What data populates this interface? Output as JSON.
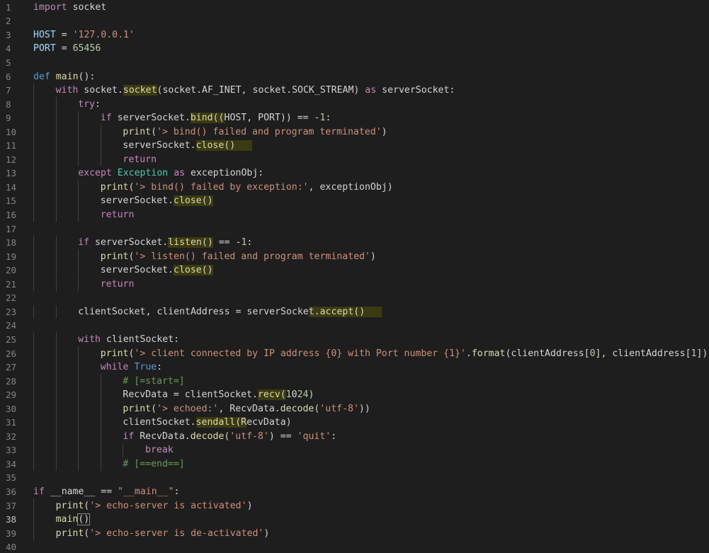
{
  "editor": {
    "language": "python",
    "active_line": 38,
    "theme": {
      "background": "#1e1e1e",
      "gutter_text": "#858585",
      "highlight": "#3b3a12"
    },
    "lines": [
      {
        "n": "1",
        "indent": 0,
        "t": [
          [
            "ctl",
            "import"
          ],
          [
            "txt",
            " socket"
          ]
        ]
      },
      {
        "n": "2",
        "indent": 0,
        "t": []
      },
      {
        "n": "3",
        "indent": 0,
        "t": [
          [
            "var",
            "HOST"
          ],
          [
            "txt",
            " = "
          ],
          [
            "str",
            "'127.0.0.1'"
          ]
        ]
      },
      {
        "n": "4",
        "indent": 0,
        "t": [
          [
            "var",
            "PORT"
          ],
          [
            "txt",
            " = "
          ],
          [
            "num",
            "65456"
          ]
        ]
      },
      {
        "n": "5",
        "indent": 0,
        "t": []
      },
      {
        "n": "6",
        "indent": 0,
        "t": [
          [
            "kw",
            "def"
          ],
          [
            "txt",
            " "
          ],
          [
            "fn",
            "main"
          ],
          [
            "txt",
            "():"
          ]
        ]
      },
      {
        "n": "7",
        "indent": 1,
        "t": [
          [
            "ctl",
            "with"
          ],
          [
            "txt",
            " socket."
          ],
          [
            "hlfn",
            "socket"
          ],
          [
            "txt",
            "(socket.AF_INET, socket.SOCK_STREAM) "
          ],
          [
            "ctl",
            "as"
          ],
          [
            "txt",
            " serverSocket:"
          ]
        ]
      },
      {
        "n": "8",
        "indent": 2,
        "t": [
          [
            "ctl",
            "try"
          ],
          [
            "txt",
            ":"
          ]
        ]
      },
      {
        "n": "9",
        "indent": 3,
        "t": [
          [
            "ctl",
            "if"
          ],
          [
            "txt",
            " serverSocket."
          ],
          [
            "hlfn",
            "bind"
          ],
          [
            "hl",
            "(("
          ],
          [
            "txt",
            "HOST, PORT)) == -"
          ],
          [
            "num",
            "1"
          ],
          [
            "txt",
            ":"
          ]
        ]
      },
      {
        "n": "10",
        "indent": 4,
        "t": [
          [
            "fn",
            "print"
          ],
          [
            "txt",
            "("
          ],
          [
            "str",
            "'> bind() failed and program terminated'"
          ],
          [
            "txt",
            ")"
          ]
        ]
      },
      {
        "n": "11",
        "indent": 4,
        "t": [
          [
            "txt",
            "serverSocket."
          ],
          [
            "hlfn",
            "close"
          ],
          [
            "hl",
            "()   "
          ]
        ]
      },
      {
        "n": "12",
        "indent": 4,
        "t": [
          [
            "ctl",
            "return"
          ]
        ]
      },
      {
        "n": "13",
        "indent": 2,
        "t": [
          [
            "ctl",
            "except"
          ],
          [
            "txt",
            " "
          ],
          [
            "cls",
            "Exception"
          ],
          [
            "txt",
            " "
          ],
          [
            "ctl",
            "as"
          ],
          [
            "txt",
            " exceptionObj:"
          ]
        ]
      },
      {
        "n": "14",
        "indent": 3,
        "t": [
          [
            "fn",
            "print"
          ],
          [
            "txt",
            "("
          ],
          [
            "str",
            "'> bind() failed by exception:'"
          ],
          [
            "txt",
            ", exceptionObj)"
          ]
        ]
      },
      {
        "n": "15",
        "indent": 3,
        "t": [
          [
            "txt",
            "serverSocket."
          ],
          [
            "hlfn",
            "close"
          ],
          [
            "hl",
            "()"
          ]
        ]
      },
      {
        "n": "16",
        "indent": 3,
        "t": [
          [
            "ctl",
            "return"
          ]
        ]
      },
      {
        "n": "17",
        "indent": 0,
        "t": []
      },
      {
        "n": "18",
        "indent": 2,
        "t": [
          [
            "ctl",
            "if"
          ],
          [
            "txt",
            " serverSocket."
          ],
          [
            "hlfn",
            "listen"
          ],
          [
            "hl",
            "()"
          ],
          [
            "txt",
            " == -"
          ],
          [
            "num",
            "1"
          ],
          [
            "txt",
            ":"
          ]
        ]
      },
      {
        "n": "19",
        "indent": 3,
        "t": [
          [
            "fn",
            "print"
          ],
          [
            "txt",
            "("
          ],
          [
            "str",
            "'> listen() failed and program terminated'"
          ],
          [
            "txt",
            ")"
          ]
        ]
      },
      {
        "n": "20",
        "indent": 3,
        "t": [
          [
            "txt",
            "serverSocket."
          ],
          [
            "hlfn",
            "close"
          ],
          [
            "hl",
            "()"
          ]
        ]
      },
      {
        "n": "21",
        "indent": 3,
        "t": [
          [
            "ctl",
            "return"
          ]
        ]
      },
      {
        "n": "22",
        "indent": 0,
        "t": []
      },
      {
        "n": "23",
        "indent": 2,
        "t": [
          [
            "txt",
            "clientSocket, clientAddress = serverSocke"
          ],
          [
            "hl",
            "t."
          ],
          [
            "hlfn",
            "accept"
          ],
          [
            "hl",
            "()   "
          ]
        ]
      },
      {
        "n": "24",
        "indent": 0,
        "t": []
      },
      {
        "n": "25",
        "indent": 2,
        "t": [
          [
            "ctl",
            "with"
          ],
          [
            "txt",
            " clientSocket:"
          ]
        ]
      },
      {
        "n": "26",
        "indent": 3,
        "t": [
          [
            "fn",
            "print"
          ],
          [
            "txt",
            "("
          ],
          [
            "str",
            "'> client connected by IP address {0} with Port number {1}'"
          ],
          [
            "txt",
            "."
          ],
          [
            "fn",
            "format"
          ],
          [
            "txt",
            "(clientAddress["
          ],
          [
            "num",
            "0"
          ],
          [
            "txt",
            "], clientAddress["
          ],
          [
            "num",
            "1"
          ],
          [
            "txt",
            "]))"
          ]
        ]
      },
      {
        "n": "27",
        "indent": 3,
        "t": [
          [
            "ctl",
            "while"
          ],
          [
            "txt",
            " "
          ],
          [
            "kw",
            "True"
          ],
          [
            "txt",
            ":"
          ]
        ]
      },
      {
        "n": "28",
        "indent": 4,
        "t": [
          [
            "cmt",
            "# [=start=]"
          ]
        ]
      },
      {
        "n": "29",
        "indent": 4,
        "t": [
          [
            "txt",
            "RecvData = clientSocket."
          ],
          [
            "hlfn",
            "recv"
          ],
          [
            "hl",
            "("
          ],
          [
            "num",
            "1"
          ],
          [
            "txt",
            "0"
          ],
          [
            "num",
            "24"
          ],
          [
            "txt",
            ")"
          ]
        ]
      },
      {
        "n": "30",
        "indent": 4,
        "t": [
          [
            "fn",
            "print"
          ],
          [
            "txt",
            "("
          ],
          [
            "str",
            "'> echoed:'"
          ],
          [
            "txt",
            ", RecvData."
          ],
          [
            "fn",
            "decode"
          ],
          [
            "txt",
            "("
          ],
          [
            "str",
            "'utf-8'"
          ],
          [
            "txt",
            "))"
          ]
        ]
      },
      {
        "n": "31",
        "indent": 4,
        "t": [
          [
            "txt",
            "clientSocket."
          ],
          [
            "hlfn",
            "sendall"
          ],
          [
            "hl",
            "("
          ],
          [
            "hl",
            "R"
          ],
          [
            "txt",
            "ecvData)"
          ]
        ]
      },
      {
        "n": "32",
        "indent": 4,
        "t": [
          [
            "ctl",
            "if"
          ],
          [
            "txt",
            " RecvData."
          ],
          [
            "fn",
            "decode"
          ],
          [
            "txt",
            "("
          ],
          [
            "str",
            "'utf-8'"
          ],
          [
            "txt",
            ") == "
          ],
          [
            "str",
            "'quit'"
          ],
          [
            "txt",
            ":"
          ]
        ]
      },
      {
        "n": "33",
        "indent": 5,
        "t": [
          [
            "ctl",
            "break"
          ]
        ]
      },
      {
        "n": "34",
        "indent": 4,
        "t": [
          [
            "cmt",
            "# [==end==]"
          ]
        ]
      },
      {
        "n": "35",
        "indent": 0,
        "t": []
      },
      {
        "n": "36",
        "indent": 0,
        "t": [
          [
            "ctl",
            "if"
          ],
          [
            "txt",
            " __name__ == "
          ],
          [
            "str",
            "\"__main__\""
          ],
          [
            "txt",
            ":"
          ]
        ]
      },
      {
        "n": "37",
        "indent": 1,
        "t": [
          [
            "fn",
            "print"
          ],
          [
            "txt",
            "("
          ],
          [
            "str",
            "'> echo-server is activated'"
          ],
          [
            "txt",
            ")"
          ]
        ]
      },
      {
        "n": "38",
        "indent": 1,
        "t": [
          [
            "fn",
            "main"
          ],
          [
            "txt",
            "()"
          ]
        ]
      },
      {
        "n": "39",
        "indent": 1,
        "t": [
          [
            "fn",
            "print"
          ],
          [
            "txt",
            "("
          ],
          [
            "str",
            "'> echo-server is de-activated'"
          ],
          [
            "txt",
            ")"
          ]
        ]
      },
      {
        "n": "40",
        "indent": 0,
        "t": []
      }
    ]
  }
}
